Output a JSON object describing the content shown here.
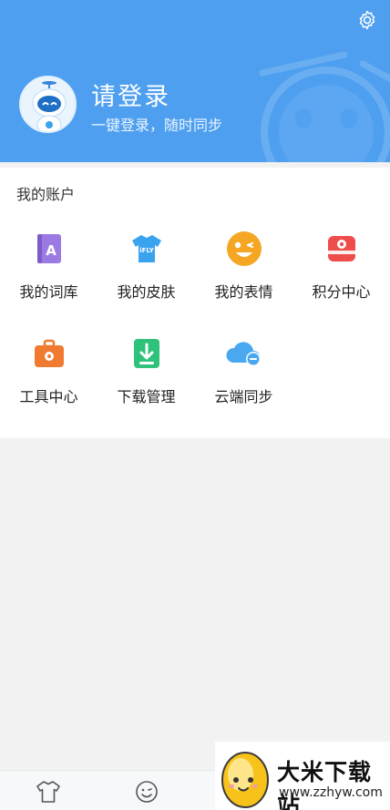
{
  "header": {
    "title": "请登录",
    "subtitle": "一键登录，随时同步"
  },
  "account": {
    "section_title": "我的账户",
    "items": [
      {
        "label": "我的词库",
        "icon": "lexicon-book-icon",
        "color": "#9b7be3"
      },
      {
        "label": "我的皮肤",
        "icon": "skin-tshirt-icon",
        "color": "#3aa3ee"
      },
      {
        "label": "我的表情",
        "icon": "emoji-wink-icon",
        "color": "#f5a623"
      },
      {
        "label": "积分中心",
        "icon": "points-center-icon",
        "color": "#ef4c4c"
      },
      {
        "label": "工具中心",
        "icon": "toolbox-icon",
        "color": "#f07a2f"
      },
      {
        "label": "下载管理",
        "icon": "download-manager-icon",
        "color": "#2fc27a"
      },
      {
        "label": "云端同步",
        "icon": "cloud-sync-icon",
        "color": "#4aa8f0"
      }
    ]
  },
  "tabbar": {
    "tabs": [
      {
        "icon": "tshirt-icon"
      },
      {
        "icon": "smile-icon"
      }
    ]
  },
  "watermark": {
    "title": "大米下载站",
    "url": "www.zzhyw.com"
  },
  "colors": {
    "header_bg": "#4f9ff0",
    "page_bg": "#f2f2f2"
  }
}
